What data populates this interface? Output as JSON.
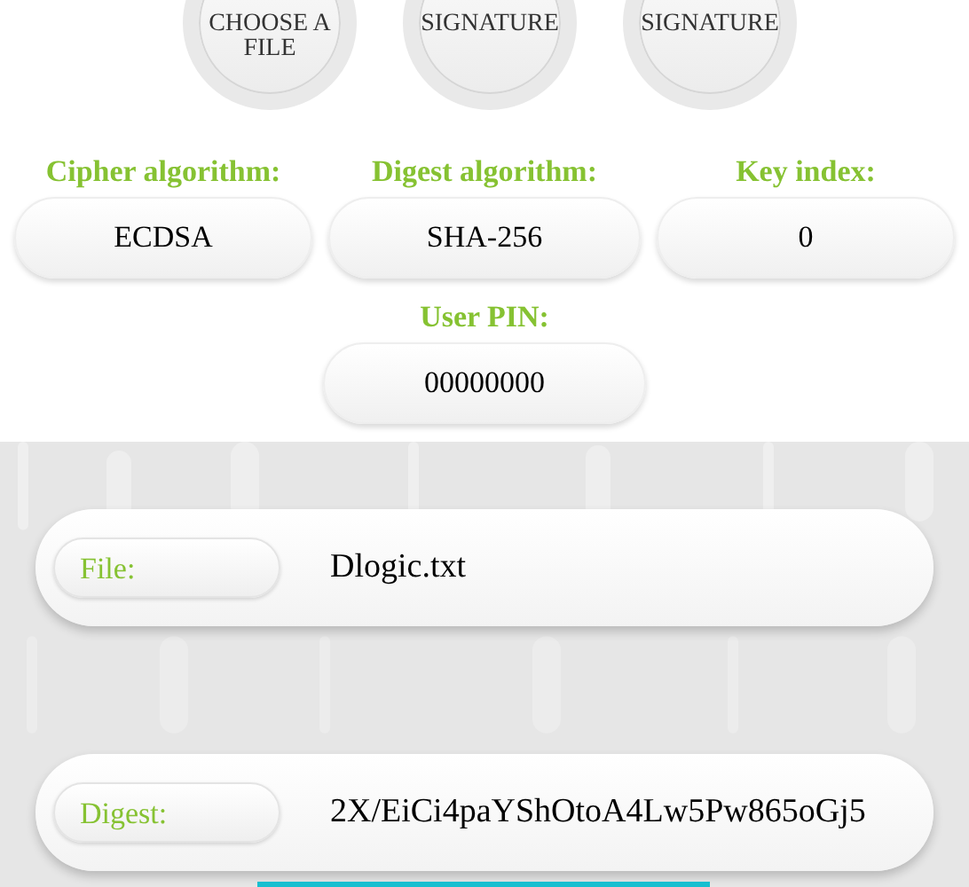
{
  "actions": [
    {
      "label": "CHOOSE A FILE"
    },
    {
      "label": "SIGNATURE"
    },
    {
      "label": "SIGNATURE"
    }
  ],
  "settings": [
    {
      "label": "Cipher algorithm:",
      "value": "ECDSA"
    },
    {
      "label": "Digest algorithm:",
      "value": "SHA-256"
    },
    {
      "label": "Key index:",
      "value": "0"
    }
  ],
  "pin": {
    "label": "User PIN:",
    "value": "00000000"
  },
  "results": [
    {
      "label": "File:",
      "value": "Dlogic.txt"
    },
    {
      "label": "Digest:",
      "value": "2X/EiCi4paYShOtoA4Lw5Pw865oGj5"
    }
  ]
}
